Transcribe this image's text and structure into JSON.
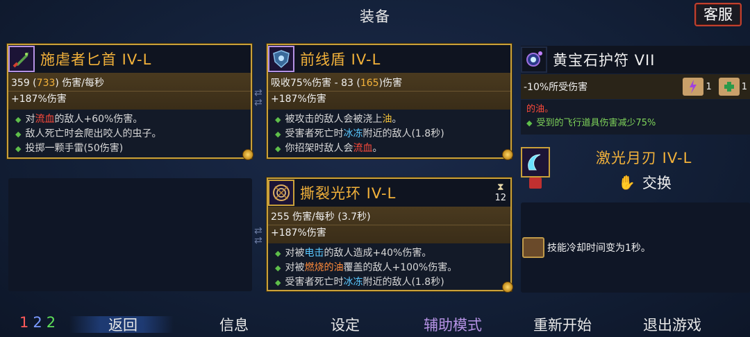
{
  "title": "装备",
  "service_button": "客服",
  "cards": {
    "dagger": {
      "name": "施虐者匕首 IV-L",
      "stat_dps_value": "359",
      "stat_dps_paren": "733",
      "stat_dps_unit": "伤害/每秒",
      "stat_bonus": "+187%伤害",
      "effects": [
        {
          "pre": "对",
          "hl": "流血",
          "post": "的敌人+60%伤害。"
        },
        {
          "text": "敌人死亡时会爬出咬人的虫子。"
        },
        {
          "text": "投掷一颗手雷(50伤害)"
        }
      ]
    },
    "shield": {
      "name": "前线盾 IV-L",
      "stat_block": "吸收75%伤害 - 83",
      "stat_block_paren": "165",
      "stat_block_unit": "伤害",
      "stat_bonus": "+187%伤害",
      "effects": [
        {
          "pre": "被攻击的敌人会被浇上",
          "hl": "油",
          "post": "。"
        },
        {
          "pre": "受害者死亡时",
          "hl": "冰冻",
          "post": "附近的敌人(1.8秒)"
        },
        {
          "pre": "你招架时敌人会",
          "hl": "流血",
          "post": "。"
        }
      ]
    },
    "aura": {
      "name": "撕裂光环 IV-L",
      "timer": "12",
      "stat_dps": "255 伤害/每秒 (3.7秒)",
      "stat_bonus": "+187%伤害",
      "effects": [
        {
          "pre": "对被",
          "hl": "电击",
          "post": "的敌人造成+40%伤害。"
        },
        {
          "pre": "对被",
          "hl": "燃烧的油",
          "post": "覆盖的敌人+100%伤害。"
        },
        {
          "pre": "受害者死亡时",
          "hl": "冰冻",
          "post": "附近的敌人(1.8秒)"
        }
      ]
    }
  },
  "amulet": {
    "name": "黄宝石护符 VII",
    "stat": "-10%所受伤害",
    "scroll1_count": "1",
    "scroll2_count": "1",
    "effect_line1": "的油。",
    "effect_line2": "受到的飞行道具伤害减少75%"
  },
  "laser": {
    "name": "激光月刃 IV-L",
    "swap_label": "交换"
  },
  "cooldown_text": "技能冷却时间变为1秒。",
  "bottom": {
    "slot_1": "1",
    "slot_2": "2",
    "slot_3": "2",
    "back": "返回",
    "info": "信息",
    "settings": "设定",
    "assist": "辅助模式",
    "restart": "重新开始",
    "quit": "退出游戏"
  },
  "colors": {
    "gold": "#f3b23a",
    "card_border": "#caa13a",
    "bleed": "#ff4a3a",
    "freeze": "#5ac8ff",
    "assist_purple": "#b592e4",
    "service_red": "#c0412f"
  },
  "icons": [
    "dagger-icon",
    "shield-icon",
    "aura-icon",
    "amulet-icon",
    "laser-moon-blade-icon",
    "scroll-lightning-icon",
    "scroll-heal-icon",
    "hourglass-icon",
    "swap-glove-icon",
    "cooldown-skill-icon"
  ]
}
